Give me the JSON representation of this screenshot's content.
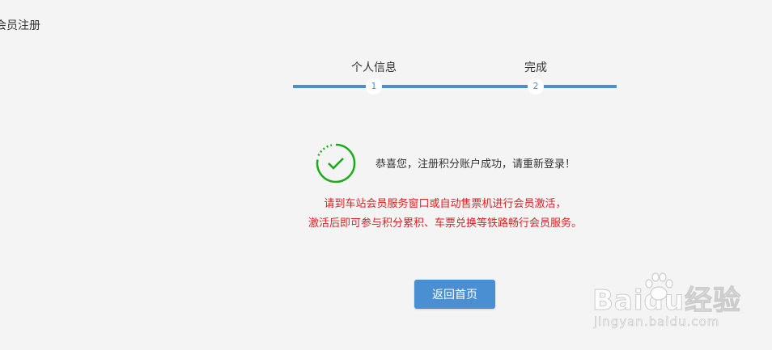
{
  "header": {
    "title": "会员注册"
  },
  "stepper": {
    "steps": [
      {
        "label": "个人信息",
        "number": "1"
      },
      {
        "label": "完成",
        "number": "2"
      }
    ]
  },
  "result": {
    "message": "恭喜您，注册积分账户成功，请重新登录！",
    "notice_line1": "请到车站会员服务窗口或自动售票机进行会员激活，",
    "notice_line2": "激活后即可参与积分累积、车票兑换等铁路畅行会员服务。"
  },
  "actions": {
    "home_label": "返回首页"
  },
  "watermark": {
    "logo": "Baidu经验",
    "url": "jingyan.baidu.com"
  },
  "colors": {
    "background": "#f4f4f4",
    "accent": "#4a8fd2",
    "success": "#1aad19",
    "warning_text": "#e02020"
  },
  "icons": {
    "success": "check-circle-icon"
  }
}
